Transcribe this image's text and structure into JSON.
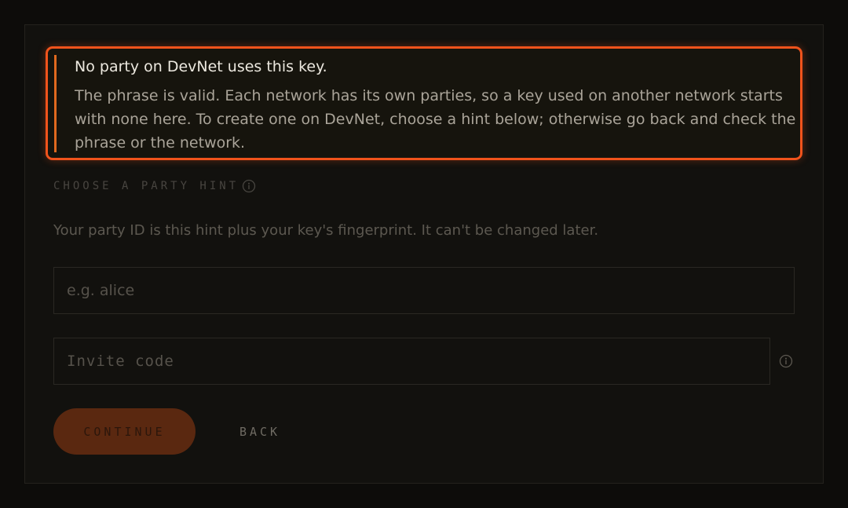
{
  "alert": {
    "title": "No party on DevNet uses this key.",
    "body": "The phrase is valid. Each network has its own parties, so a key used on another network starts with none here. To create one on DevNet, choose a hint below; otherwise go back and check the phrase or the network.",
    "accent_color": "#f0531c"
  },
  "party_hint": {
    "label": "CHOOSE A PARTY HINT",
    "info_icon": "info-icon",
    "helper": "Your party ID is this hint plus your key's fingerprint. It can't be changed later.",
    "placeholder": "e.g. alice",
    "value": ""
  },
  "invite": {
    "placeholder": "Invite code",
    "value": "",
    "info_icon": "info-icon"
  },
  "actions": {
    "continue_label": "CONTINUE",
    "back_label": "BACK",
    "continue_color": "#5a2810"
  }
}
